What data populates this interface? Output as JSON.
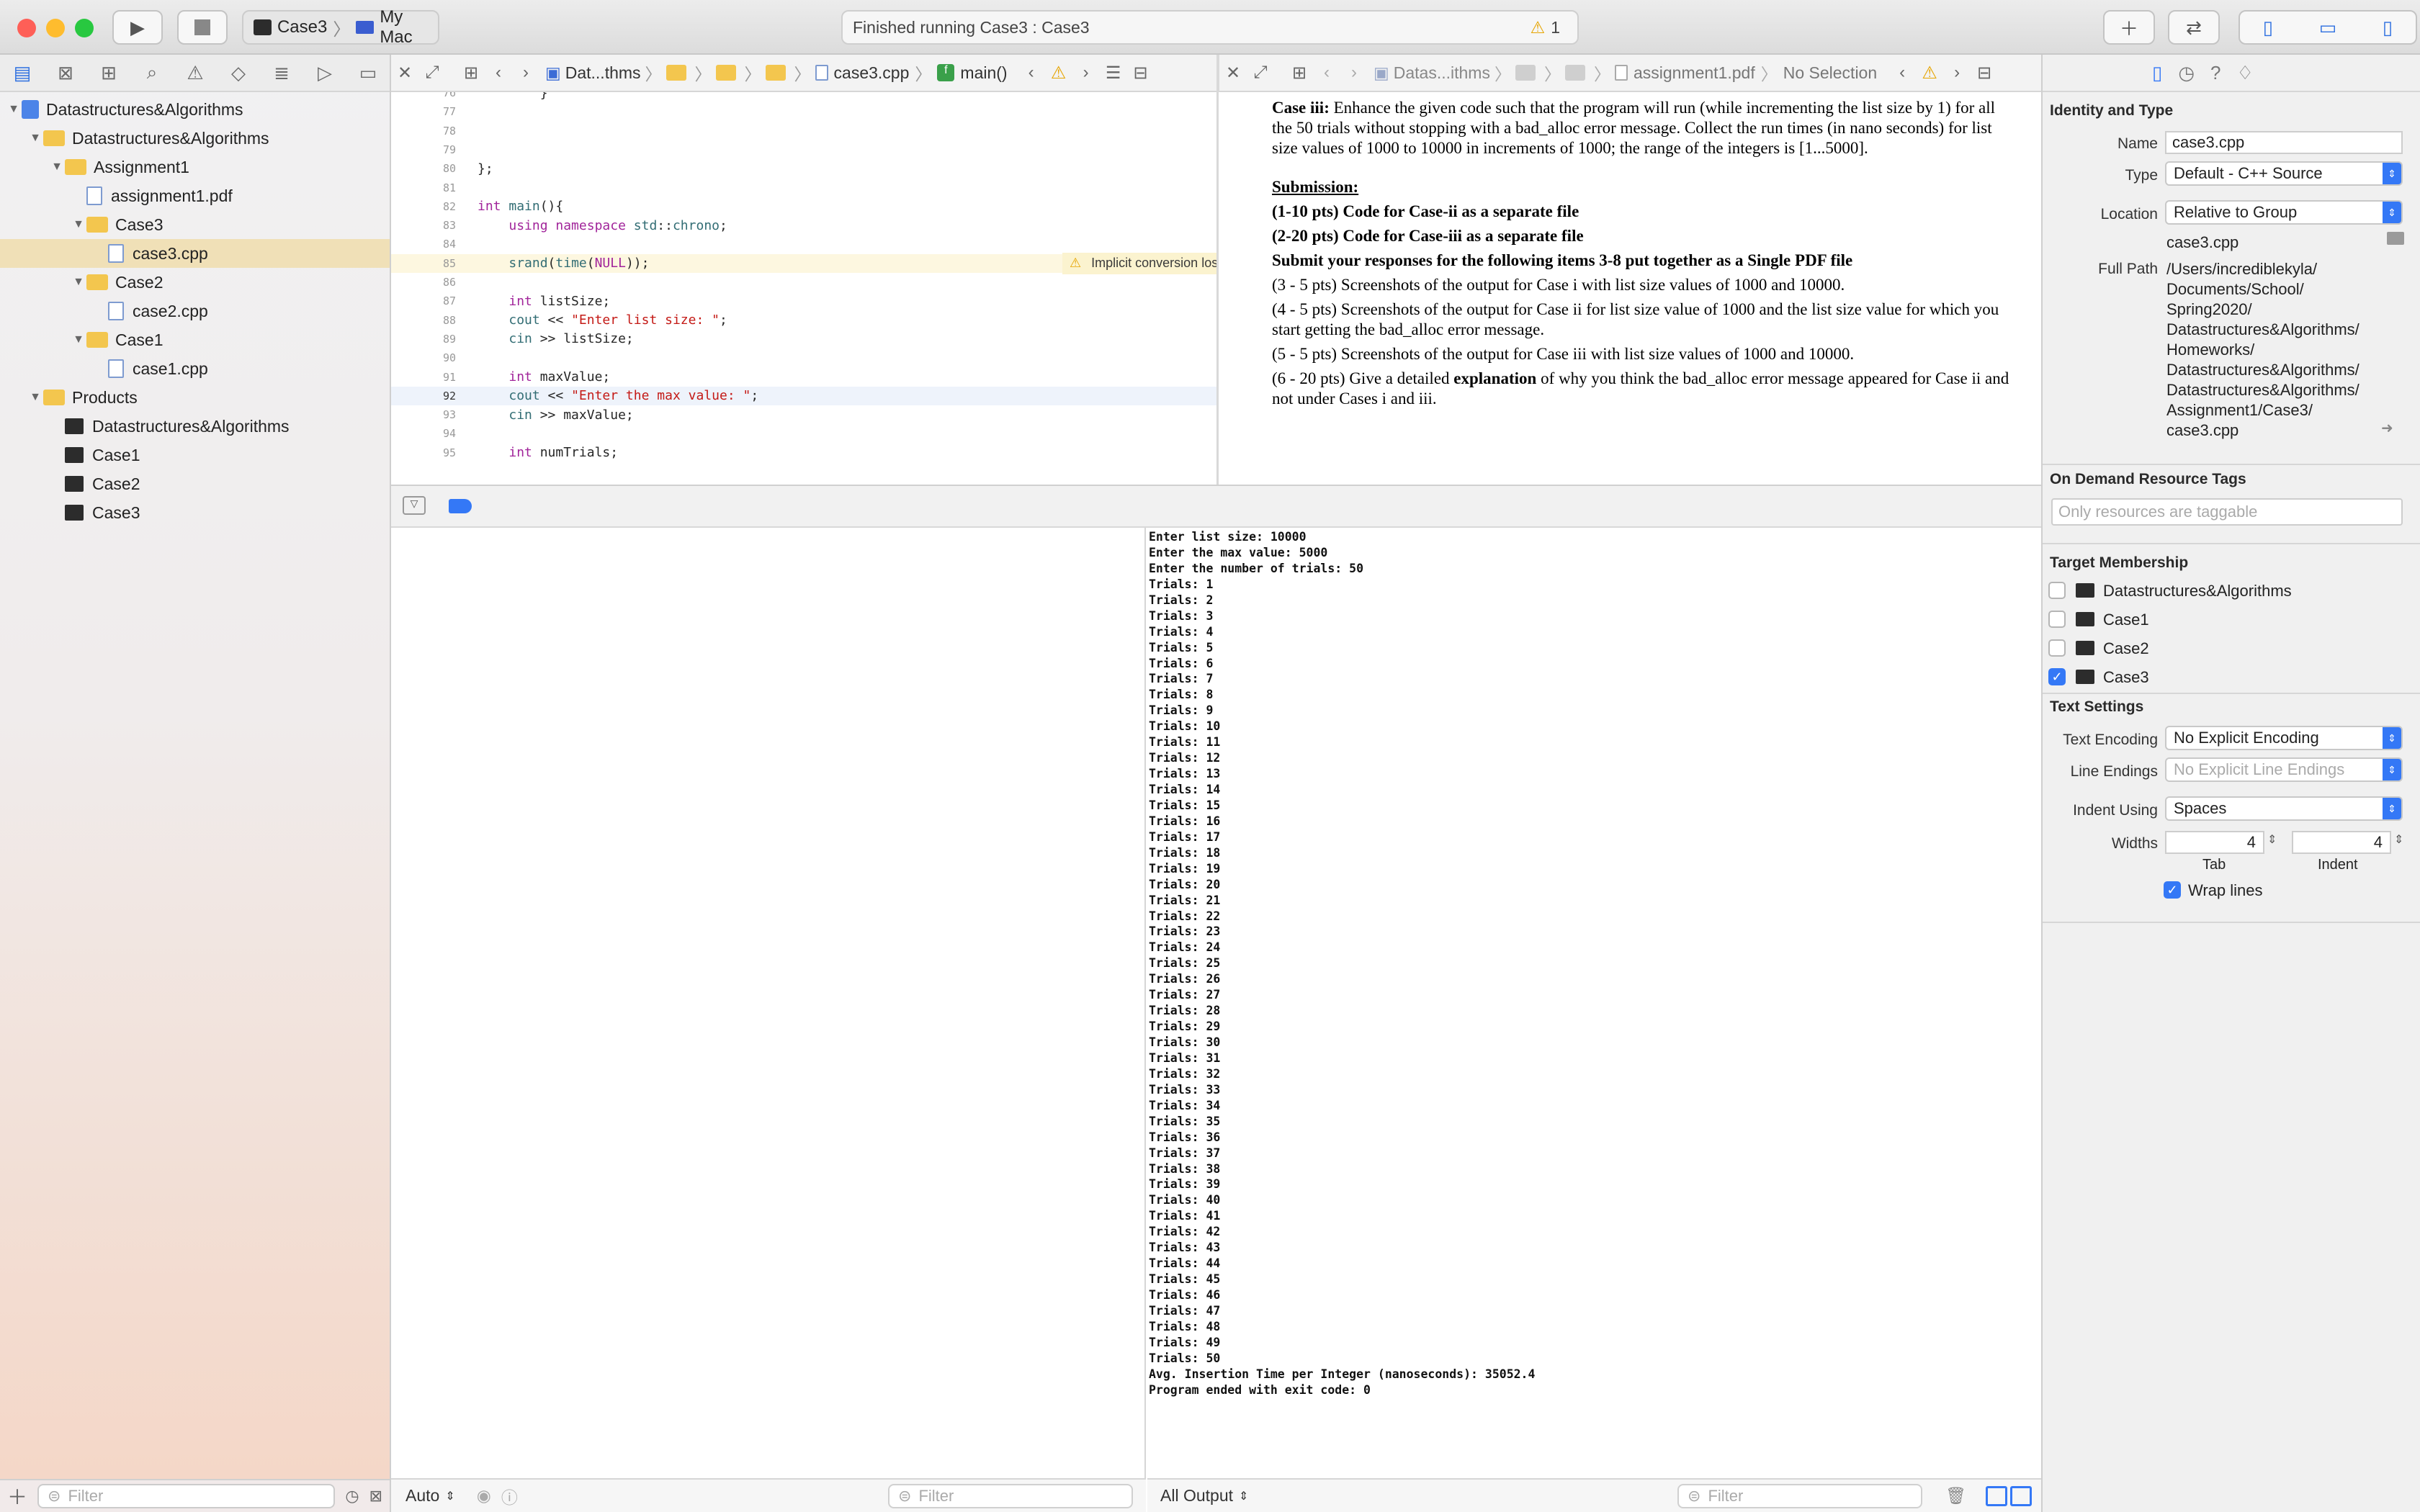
{
  "toolbar": {
    "scheme_target": "Case3",
    "scheme_device": "My Mac",
    "status_text": "Finished running Case3 : Case3",
    "warning_count": "1"
  },
  "navigator": {
    "items": [
      {
        "label": "Datastructures&Algorithms",
        "kind": "project",
        "depth": 0,
        "expanded": true
      },
      {
        "label": "Datastructures&Algorithms",
        "kind": "folder",
        "depth": 1,
        "expanded": true
      },
      {
        "label": "Assignment1",
        "kind": "folder",
        "depth": 2,
        "expanded": true
      },
      {
        "label": "assignment1.pdf",
        "kind": "pdf",
        "depth": 3
      },
      {
        "label": "Case3",
        "kind": "folder",
        "depth": 3,
        "expanded": true
      },
      {
        "label": "case3.cpp",
        "kind": "cpp",
        "depth": 4,
        "selected": true
      },
      {
        "label": "Case2",
        "kind": "folder",
        "depth": 3,
        "expanded": true
      },
      {
        "label": "case2.cpp",
        "kind": "cpp",
        "depth": 4
      },
      {
        "label": "Case1",
        "kind": "folder",
        "depth": 3,
        "expanded": true
      },
      {
        "label": "case1.cpp",
        "kind": "cpp",
        "depth": 4
      },
      {
        "label": "Products",
        "kind": "folder",
        "depth": 1,
        "expanded": true
      },
      {
        "label": "Datastructures&Algorithms",
        "kind": "product",
        "depth": 2
      },
      {
        "label": "Case1",
        "kind": "product",
        "depth": 2
      },
      {
        "label": "Case2",
        "kind": "product",
        "depth": 2
      },
      {
        "label": "Case3",
        "kind": "product",
        "depth": 2
      }
    ],
    "filter_placeholder": "Filter"
  },
  "editor_left": {
    "crumbs": [
      "Dat...thms",
      "case3.cpp",
      "main()"
    ],
    "lines": [
      {
        "n": "76",
        "html": "        }"
      },
      {
        "n": "77",
        "html": ""
      },
      {
        "n": "78",
        "html": ""
      },
      {
        "n": "79",
        "html": ""
      },
      {
        "n": "80",
        "html": "};"
      },
      {
        "n": "81",
        "html": ""
      },
      {
        "n": "82",
        "html": "<span class='kw'>int</span> <span class='fn'>main</span>(){"
      },
      {
        "n": "83",
        "html": "    <span class='kw'>using namespace</span> <span class='fn'>std</span>::<span class='fn'>chrono</span>;"
      },
      {
        "n": "84",
        "html": ""
      },
      {
        "n": "85",
        "html": "    <span class='fn'>srand</span>(<span class='fn'>time</span>(<span class='kw'>NULL</span>));"
      },
      {
        "n": "86",
        "html": ""
      },
      {
        "n": "87",
        "html": "    <span class='kw'>int</span> listSize;"
      },
      {
        "n": "88",
        "html": "    <span class='fn'>cout</span> &lt;&lt; <span class='st'>\"Enter list size: \"</span>;"
      },
      {
        "n": "89",
        "html": "    <span class='fn'>cin</span> &gt;&gt; listSize;"
      },
      {
        "n": "90",
        "html": ""
      },
      {
        "n": "91",
        "html": "    <span class='kw'>int</span> maxValue;"
      },
      {
        "n": "92",
        "html": "    <span class='fn'>cout</span> &lt;&lt; <span class='st'>\"Enter the max value: \"</span>;"
      },
      {
        "n": "93",
        "html": "    <span class='fn'>cin</span> &gt;&gt; maxValue;"
      },
      {
        "n": "94",
        "html": ""
      },
      {
        "n": "95",
        "html": "    <span class='kw'>int</span> numTrials;"
      }
    ],
    "warning_text": "Implicit conversion loses integer precision: 'time_t' (aka 'long') to 'unsigned int'"
  },
  "editor_right": {
    "crumbs": [
      "Datas...ithms",
      "assignment1.pdf",
      "No Selection"
    ],
    "case_iii_label": "Case iii:",
    "case_iii_text": " Enhance the given code such that the program will run (while incrementing the list size by 1) for all the 50 trials without stopping with a bad_alloc error message. Collect the run times (in nano seconds) for list size values of 1000 to 10000 in increments of 1000; the range of the integers is [1...5000].",
    "submission": "Submission:",
    "item1": "(1-10 pts) Code for Case-ii as a separate file",
    "item2": "(2-20 pts) Code for Case-iii as a separate file",
    "item3": "Submit your responses for the following items 3-8 put together as a Single PDF file",
    "item4": "(3 - 5 pts) Screenshots of the output for Case i with list size values of 1000 and 10000.",
    "item5": "(4 - 5 pts) Screenshots of the output for Case ii for list size value of 1000 and the list size value for which you start getting the bad_alloc error message.",
    "item6": "(5 - 5 pts) Screenshots of the output for Case iii with list size values of 1000 and 10000.",
    "item7_a": "(6 - 20 pts) Give a detailed ",
    "item7_b": "explanation",
    "item7_c": " of why you think the bad_alloc error message appeared for Case ii and not under Cases i and iii."
  },
  "console": {
    "header": [
      "Enter list size: 10000",
      "Enter the max value: 5000",
      "Enter the number of trials: 50"
    ],
    "trial_prefix": "Trials: ",
    "trial_count": 50,
    "footer": [
      "Avg. Insertion Time per Integer (nanoseconds): 35052.4",
      "Program ended with exit code: 0"
    ]
  },
  "debug_footer": {
    "auto_label": "Auto",
    "filter_placeholder": "Filter",
    "output_label": "All Output"
  },
  "inspector": {
    "identity_title": "Identity and Type",
    "name_label": "Name",
    "name_value": "case3.cpp",
    "type_label": "Type",
    "type_value": "Default - C++ Source",
    "location_label": "Location",
    "location_value": "Relative to Group",
    "location_file": "case3.cpp",
    "fullpath_label": "Full Path",
    "fullpath_lines": [
      "/Users/incrediblekyla/",
      "Documents/School/",
      "Spring2020/",
      "Datastructures&Algorithms/",
      "Homeworks/",
      "Datastructures&Algorithms/",
      "Datastructures&Algorithms/",
      "Assignment1/Case3/",
      "case3.cpp"
    ],
    "odr_title": "On Demand Resource Tags",
    "odr_placeholder": "Only resources are taggable",
    "target_title": "Target Membership",
    "targets": [
      {
        "label": "Datastructures&Algorithms",
        "checked": false
      },
      {
        "label": "Case1",
        "checked": false
      },
      {
        "label": "Case2",
        "checked": false
      },
      {
        "label": "Case3",
        "checked": true
      }
    ],
    "text_title": "Text Settings",
    "encoding_label": "Text Encoding",
    "encoding_value": "No Explicit Encoding",
    "endings_label": "Line Endings",
    "endings_value": "No Explicit Line Endings",
    "indent_label": "Indent Using",
    "indent_value": "Spaces",
    "widths_label": "Widths",
    "tab_value": "4",
    "indent_value_num": "4",
    "tab_label": "Tab",
    "indent_col_label": "Indent",
    "wrap_label": "Wrap lines"
  }
}
